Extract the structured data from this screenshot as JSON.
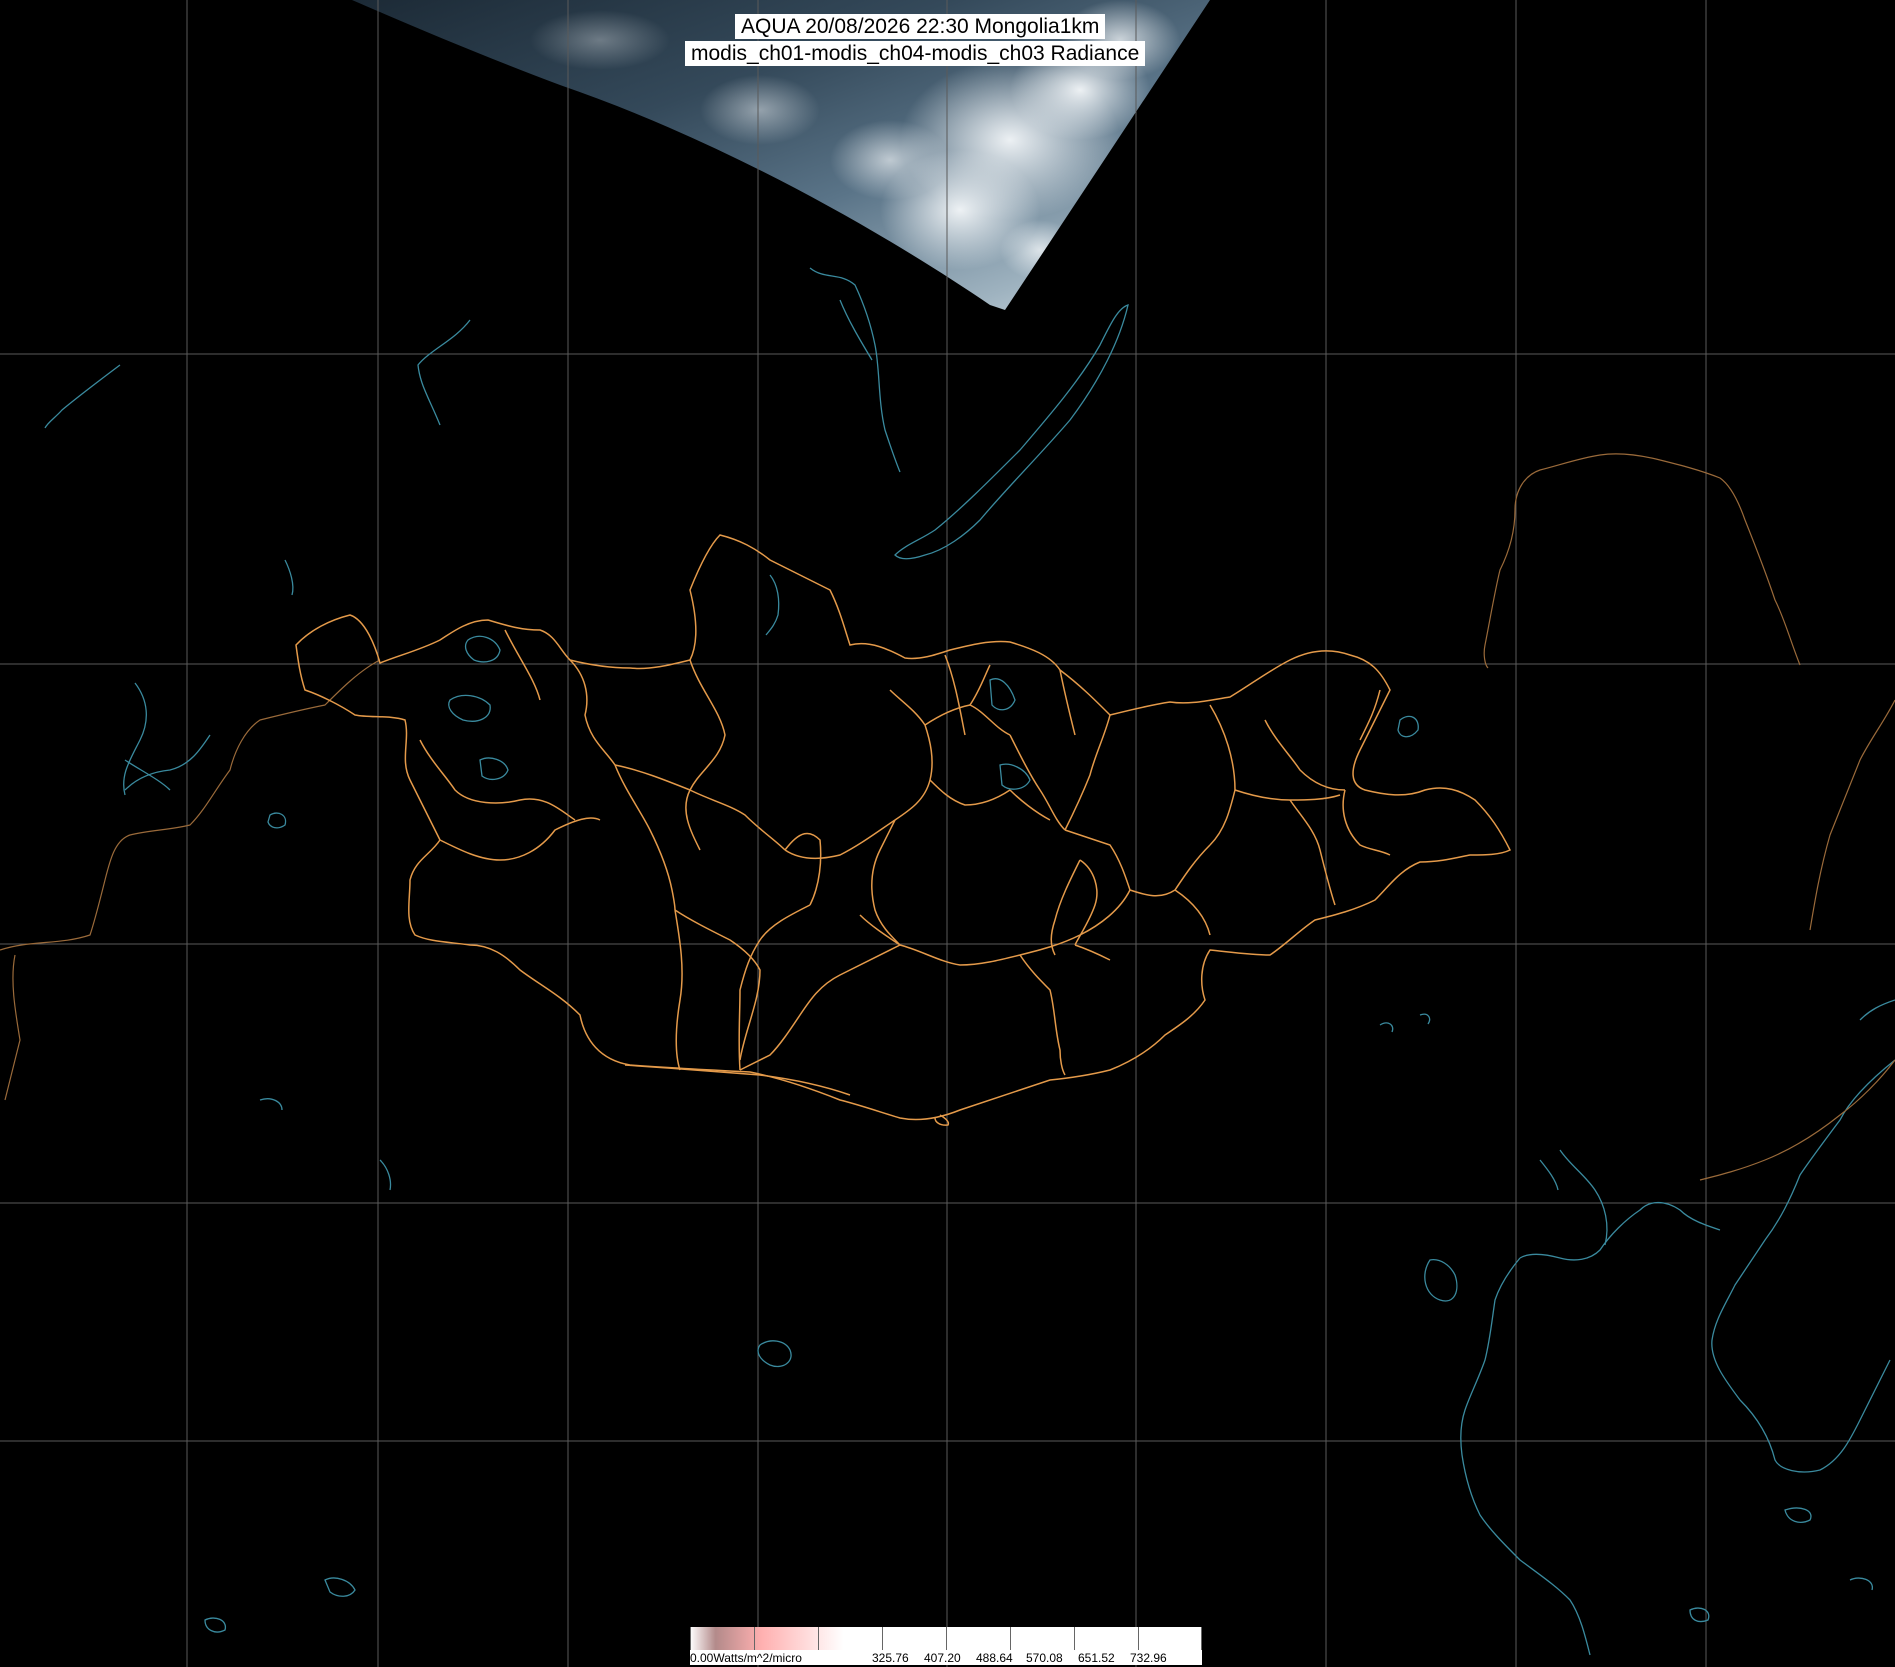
{
  "title": {
    "line1": "AQUA 20/08/2026 22:30 Mongolia1km",
    "line2": "modis_ch01-modis_ch04-modis_ch03 Radiance"
  },
  "colorbar": {
    "unit_label": "0.00Watts/m^2/micro",
    "values": [
      "325.76",
      "407.20",
      "488.64",
      "570.08",
      "651.52",
      "732.96"
    ]
  },
  "colors": {
    "background": "#000000",
    "graticule": "#5a5a5a",
    "mongolia_borders": "#e49a4a",
    "coastline_water": "#3a8a9e",
    "national_border": "#9a6a3a"
  },
  "features": {
    "satellite_swath": "cloud-imagery-swath",
    "region": "Mongolia"
  }
}
